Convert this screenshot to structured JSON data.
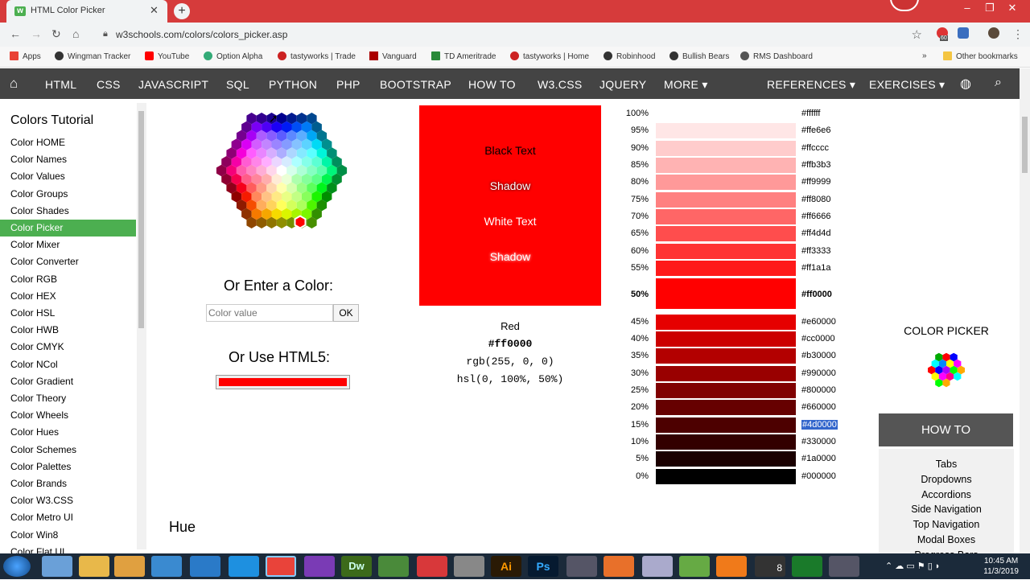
{
  "browser": {
    "tab_title": "HTML Color Picker",
    "url": "w3schools.com/colors/colors_picker.asp",
    "badge": "60"
  },
  "bookmarks": [
    "Apps",
    "Wingman Tracker",
    "YouTube",
    "Option Alpha",
    "tastyworks | Trade",
    "Vanguard",
    "TD Ameritrade",
    "tastyworks | Home",
    "Robinhood",
    "Bullish Bears",
    "RMS Dashboard"
  ],
  "other_bookmarks": "Other bookmarks",
  "topnav": [
    "HTML",
    "CSS",
    "JAVASCRIPT",
    "SQL",
    "PYTHON",
    "PHP",
    "BOOTSTRAP",
    "HOW TO",
    "W3.CSS",
    "JQUERY",
    "MORE ▾",
    "REFERENCES ▾",
    "EXERCISES ▾"
  ],
  "sidebar": {
    "title": "Colors Tutorial",
    "items": [
      "Color HOME",
      "Color Names",
      "Color Values",
      "Color Groups",
      "Color Shades",
      "Color Picker",
      "Color Mixer",
      "Color Converter",
      "Color RGB",
      "Color HEX",
      "Color HSL",
      "Color HWB",
      "Color CMYK",
      "Color NCol",
      "Color Gradient",
      "Color Theory",
      "Color Wheels",
      "Color Hues",
      "Color Schemes",
      "Color Palettes",
      "Color Brands",
      "Color W3.CSS",
      "Color Metro UI",
      "Color Win8",
      "Color Flat UI"
    ],
    "active_index": 5
  },
  "picker": {
    "or_enter": "Or Enter a Color:",
    "input_placeholder": "Color value",
    "ok": "OK",
    "or_html5": "Or Use HTML5:",
    "html5_value": "#ff0000"
  },
  "swatch": {
    "color": "#ff0000",
    "black_text": "Black Text",
    "shadow1": "Shadow",
    "white_text": "White Text",
    "shadow2": "Shadow"
  },
  "info": {
    "name": "Red",
    "hex": "#ff0000",
    "rgb": "rgb(255, 0, 0)",
    "hsl": "hsl(0, 100%, 50%)"
  },
  "shades": [
    {
      "pct": "100%",
      "hex": "#ffffff"
    },
    {
      "pct": "95%",
      "hex": "#ffe6e6"
    },
    {
      "pct": "90%",
      "hex": "#ffcccc"
    },
    {
      "pct": "85%",
      "hex": "#ffb3b3"
    },
    {
      "pct": "80%",
      "hex": "#ff9999"
    },
    {
      "pct": "75%",
      "hex": "#ff8080"
    },
    {
      "pct": "70%",
      "hex": "#ff6666"
    },
    {
      "pct": "65%",
      "hex": "#ff4d4d"
    },
    {
      "pct": "60%",
      "hex": "#ff3333"
    },
    {
      "pct": "55%",
      "hex": "#ff1a1a"
    },
    {
      "pct": "50%",
      "hex": "#ff0000"
    },
    {
      "pct": "45%",
      "hex": "#e60000"
    },
    {
      "pct": "40%",
      "hex": "#cc0000"
    },
    {
      "pct": "35%",
      "hex": "#b30000"
    },
    {
      "pct": "30%",
      "hex": "#990000"
    },
    {
      "pct": "25%",
      "hex": "#800000"
    },
    {
      "pct": "20%",
      "hex": "#660000"
    },
    {
      "pct": "15%",
      "hex": "#4d0000"
    },
    {
      "pct": "10%",
      "hex": "#330000"
    },
    {
      "pct": "5%",
      "hex": "#1a0000"
    },
    {
      "pct": "0%",
      "hex": "#000000"
    }
  ],
  "selected_hex": "#4d0000",
  "right": {
    "color_picker": "COLOR PICKER",
    "howto": "HOW TO",
    "howto_items": [
      "Tabs",
      "Dropdowns",
      "Accordions",
      "Side Navigation",
      "Top Navigation",
      "Modal Boxes",
      "Progress Bars"
    ]
  },
  "hue_label": "Hue",
  "clock": {
    "time": "10:45 AM",
    "date": "11/3/2019"
  },
  "tray_badge": "8"
}
